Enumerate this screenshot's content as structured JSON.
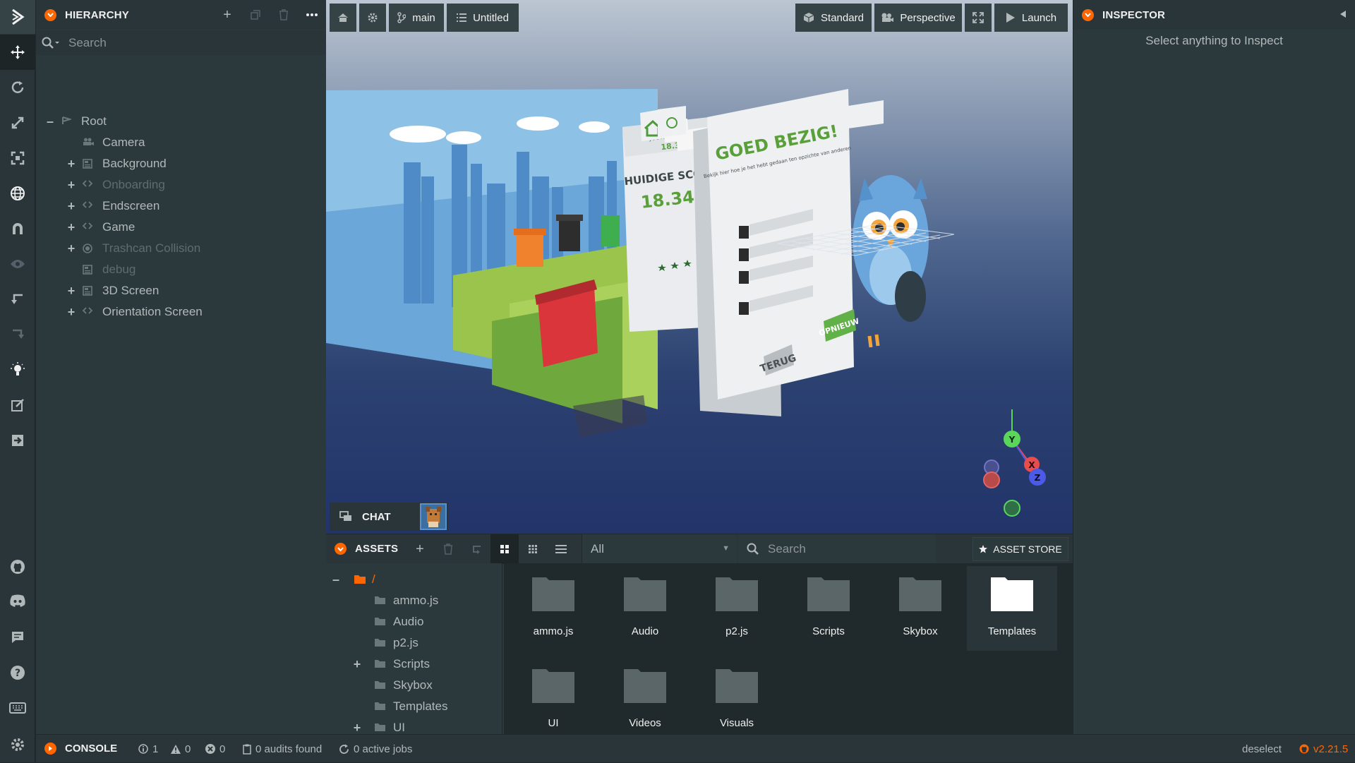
{
  "hierarchy": {
    "title": "HIERARCHY",
    "search_placeholder": "Search",
    "items": [
      {
        "label": "Root",
        "expander": "–",
        "dim": false
      },
      {
        "label": "Camera",
        "expander": "",
        "dim": false
      },
      {
        "label": "Background",
        "expander": "+",
        "dim": false
      },
      {
        "label": "Onboarding",
        "expander": "+",
        "dim": true
      },
      {
        "label": "Endscreen",
        "expander": "+",
        "dim": false
      },
      {
        "label": "Game",
        "expander": "+",
        "dim": false
      },
      {
        "label": "Trashcan Collision",
        "expander": "+",
        "dim": true
      },
      {
        "label": "debug",
        "expander": "",
        "dim": true
      },
      {
        "label": "3D Screen",
        "expander": "+",
        "dim": false
      },
      {
        "label": "Orientation Screen",
        "expander": "+",
        "dim": false
      }
    ]
  },
  "viewport": {
    "branch": "main",
    "scene": "Untitled",
    "render_mode": "Standard",
    "camera": "Perspective",
    "launch": "Launch",
    "gizmo": {
      "y": "Y",
      "x": "X",
      "z": "Z"
    },
    "scene_text": {
      "title": "GOED BEZIG!",
      "subtitle": "Bekijk hier hoe je het hebt gedaan ten opzichte van anderen",
      "score_label": "HUIDIGE SCORE:",
      "score": "18.341",
      "best_label": "JOUW HIGHSCORE",
      "best": "18.341",
      "back_button": "TERUG",
      "again_button": "OPNIEUW"
    }
  },
  "chat": {
    "label": "CHAT"
  },
  "inspector": {
    "title": "INSPECTOR",
    "empty_message": "Select anything to Inspect"
  },
  "assets": {
    "title": "ASSETS",
    "filter": "All",
    "search_placeholder": "Search",
    "store_label": "ASSET STORE",
    "root_label": "/",
    "tree": [
      {
        "label": "ammo.js",
        "expander": ""
      },
      {
        "label": "Audio",
        "expander": ""
      },
      {
        "label": "p2.js",
        "expander": ""
      },
      {
        "label": "Scripts",
        "expander": "+"
      },
      {
        "label": "Skybox",
        "expander": ""
      },
      {
        "label": "Templates",
        "expander": ""
      },
      {
        "label": "UI",
        "expander": "+"
      }
    ],
    "grid": [
      "ammo.js",
      "Audio",
      "p2.js",
      "Scripts",
      "Skybox",
      "Templates",
      "UI",
      "Videos",
      "Visuals"
    ]
  },
  "console": {
    "title": "CONSOLE",
    "info_count": "1",
    "warning_count": "0",
    "error_count": "0",
    "audits": "0 audits found",
    "jobs": "0 active jobs",
    "deselect": "deselect",
    "version": "v2.21.5"
  },
  "colors": {
    "accent": "#ff6600",
    "panel": "#2c393c",
    "header": "#293538",
    "dark": "#20292b"
  }
}
